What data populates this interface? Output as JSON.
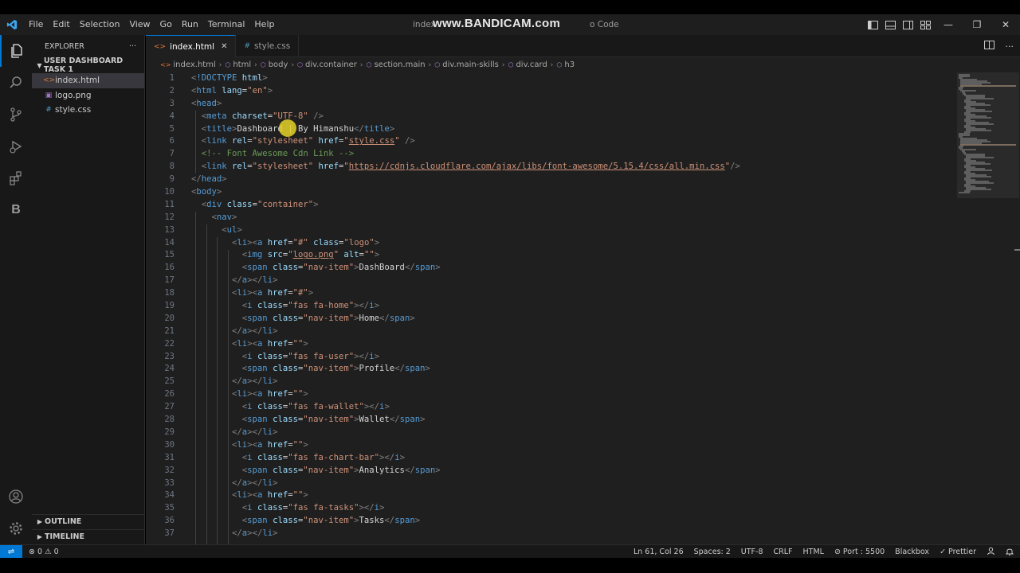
{
  "watermark": "www.BANDICAM.com",
  "window": {
    "title_left": "index",
    "title_right": "o Code",
    "minimize": "—",
    "restore": "❐",
    "close": "✕"
  },
  "menu": [
    "File",
    "Edit",
    "Selection",
    "View",
    "Go",
    "Run",
    "Terminal",
    "Help"
  ],
  "sidebar": {
    "title": "EXPLORER",
    "more": "···",
    "folder": "USER DASHBOARD TASK 1",
    "files": [
      {
        "name": "index.html",
        "icon": "html-file-icon",
        "glyph": "<>"
      },
      {
        "name": "logo.png",
        "icon": "image-file-icon",
        "glyph": "▣"
      },
      {
        "name": "style.css",
        "icon": "css-file-icon",
        "glyph": "#"
      }
    ],
    "outline": "OUTLINE",
    "timeline": "TIMELINE"
  },
  "tabs": [
    {
      "label": "index.html",
      "glyph": "<>",
      "active": true,
      "close": "✕"
    },
    {
      "label": "style.css",
      "glyph": "#",
      "active": false
    }
  ],
  "breadcrumb": [
    "index.html",
    "html",
    "body",
    "div.container",
    "section.main",
    "div.main-skills",
    "div.card",
    "h3"
  ],
  "editor": {
    "line_numbers": [
      "1",
      "2",
      "3",
      "4",
      "5",
      "6",
      "7",
      "8",
      "9",
      "10",
      "11",
      "12",
      "13",
      "14",
      "15",
      "16",
      "17",
      "18",
      "19",
      "20",
      "21",
      "22",
      "23",
      "24",
      "25",
      "26",
      "27",
      "28",
      "29",
      "30",
      "31",
      "32",
      "33",
      "34",
      "35",
      "36",
      "37"
    ],
    "lines": [
      [
        [
          "t-br",
          "<"
        ],
        [
          "t-tag",
          "!DOCTYPE"
        ],
        [
          "t-attr",
          " html"
        ],
        [
          "t-br",
          ">"
        ]
      ],
      [
        [
          "t-br",
          "<"
        ],
        [
          "t-tag",
          "html"
        ],
        [
          "t-attr",
          " lang"
        ],
        [
          "t-txt",
          "="
        ],
        [
          "t-str",
          "\"en\""
        ],
        [
          "t-br",
          ">"
        ]
      ],
      [
        [
          "t-br",
          "<"
        ],
        [
          "t-tag",
          "head"
        ],
        [
          "t-br",
          ">"
        ]
      ],
      [
        [
          "t-txt",
          "  "
        ],
        [
          "t-br",
          "<"
        ],
        [
          "t-tag",
          "meta"
        ],
        [
          "t-attr",
          " charset"
        ],
        [
          "t-txt",
          "="
        ],
        [
          "t-str",
          "\"UTF-8\""
        ],
        [
          "t-txt",
          " "
        ],
        [
          "t-br",
          "/>"
        ]
      ],
      [
        [
          "t-txt",
          "  "
        ],
        [
          "t-br",
          "<"
        ],
        [
          "t-tag",
          "title"
        ],
        [
          "t-br",
          ">"
        ],
        [
          "t-txt",
          "Dashboard | By Himanshu"
        ],
        [
          "t-br",
          "</"
        ],
        [
          "t-tag",
          "title"
        ],
        [
          "t-br",
          ">"
        ]
      ],
      [
        [
          "t-txt",
          "  "
        ],
        [
          "t-br",
          "<"
        ],
        [
          "t-tag",
          "link"
        ],
        [
          "t-attr",
          " rel"
        ],
        [
          "t-txt",
          "="
        ],
        [
          "t-str",
          "\"stylesheet\""
        ],
        [
          "t-attr",
          " href"
        ],
        [
          "t-txt",
          "="
        ],
        [
          "t-str",
          "\""
        ],
        [
          "t-link",
          "style.css"
        ],
        [
          "t-str",
          "\""
        ],
        [
          "t-txt",
          " "
        ],
        [
          "t-br",
          "/>"
        ]
      ],
      [
        [
          "t-txt",
          "  "
        ],
        [
          "t-com",
          "<!-- Font Awesome Cdn Link -->"
        ]
      ],
      [
        [
          "t-txt",
          "  "
        ],
        [
          "t-br",
          "<"
        ],
        [
          "t-tag",
          "link"
        ],
        [
          "t-attr",
          " rel"
        ],
        [
          "t-txt",
          "="
        ],
        [
          "t-str",
          "\"stylesheet\""
        ],
        [
          "t-attr",
          " href"
        ],
        [
          "t-txt",
          "="
        ],
        [
          "t-str",
          "\""
        ],
        [
          "t-link",
          "https://cdnjs.cloudflare.com/ajax/libs/font-awesome/5.15.4/css/all.min.css"
        ],
        [
          "t-str",
          "\""
        ],
        [
          "t-br",
          "/>"
        ]
      ],
      [
        [
          "t-br",
          "</"
        ],
        [
          "t-tag",
          "head"
        ],
        [
          "t-br",
          ">"
        ]
      ],
      [
        [
          "t-br",
          "<"
        ],
        [
          "t-tag",
          "body"
        ],
        [
          "t-br",
          ">"
        ]
      ],
      [
        [
          "t-txt",
          "  "
        ],
        [
          "t-br",
          "<"
        ],
        [
          "t-tag",
          "div"
        ],
        [
          "t-attr",
          " class"
        ],
        [
          "t-txt",
          "="
        ],
        [
          "t-str",
          "\"container\""
        ],
        [
          "t-br",
          ">"
        ]
      ],
      [
        [
          "t-txt",
          "    "
        ],
        [
          "t-br",
          "<"
        ],
        [
          "t-tag",
          "nav"
        ],
        [
          "t-br",
          ">"
        ]
      ],
      [
        [
          "t-txt",
          "      "
        ],
        [
          "t-br",
          "<"
        ],
        [
          "t-tag",
          "ul"
        ],
        [
          "t-br",
          ">"
        ]
      ],
      [
        [
          "t-txt",
          "        "
        ],
        [
          "t-br",
          "<"
        ],
        [
          "t-tag",
          "li"
        ],
        [
          "t-br",
          "><"
        ],
        [
          "t-tag",
          "a"
        ],
        [
          "t-attr",
          " href"
        ],
        [
          "t-txt",
          "="
        ],
        [
          "t-str",
          "\"#\""
        ],
        [
          "t-attr",
          " class"
        ],
        [
          "t-txt",
          "="
        ],
        [
          "t-str",
          "\"logo\""
        ],
        [
          "t-br",
          ">"
        ]
      ],
      [
        [
          "t-txt",
          "          "
        ],
        [
          "t-br",
          "<"
        ],
        [
          "t-tag",
          "img"
        ],
        [
          "t-attr",
          " src"
        ],
        [
          "t-txt",
          "="
        ],
        [
          "t-str",
          "\""
        ],
        [
          "t-link",
          "logo.png"
        ],
        [
          "t-str",
          "\""
        ],
        [
          "t-attr",
          " alt"
        ],
        [
          "t-txt",
          "="
        ],
        [
          "t-str",
          "\"\""
        ],
        [
          "t-br",
          ">"
        ]
      ],
      [
        [
          "t-txt",
          "          "
        ],
        [
          "t-br",
          "<"
        ],
        [
          "t-tag",
          "span"
        ],
        [
          "t-attr",
          " class"
        ],
        [
          "t-txt",
          "="
        ],
        [
          "t-str",
          "\"nav-item\""
        ],
        [
          "t-br",
          ">"
        ],
        [
          "t-txt",
          "DashBoard"
        ],
        [
          "t-br",
          "</"
        ],
        [
          "t-tag",
          "span"
        ],
        [
          "t-br",
          ">"
        ]
      ],
      [
        [
          "t-txt",
          "        "
        ],
        [
          "t-br",
          "</"
        ],
        [
          "t-tag",
          "a"
        ],
        [
          "t-br",
          "></"
        ],
        [
          "t-tag",
          "li"
        ],
        [
          "t-br",
          ">"
        ]
      ],
      [
        [
          "t-txt",
          "        "
        ],
        [
          "t-br",
          "<"
        ],
        [
          "t-tag",
          "li"
        ],
        [
          "t-br",
          "><"
        ],
        [
          "t-tag",
          "a"
        ],
        [
          "t-attr",
          " href"
        ],
        [
          "t-txt",
          "="
        ],
        [
          "t-str",
          "\"#\""
        ],
        [
          "t-br",
          ">"
        ]
      ],
      [
        [
          "t-txt",
          "          "
        ],
        [
          "t-br",
          "<"
        ],
        [
          "t-tag",
          "i"
        ],
        [
          "t-attr",
          " class"
        ],
        [
          "t-txt",
          "="
        ],
        [
          "t-str",
          "\"fas fa-home\""
        ],
        [
          "t-br",
          "></"
        ],
        [
          "t-tag",
          "i"
        ],
        [
          "t-br",
          ">"
        ]
      ],
      [
        [
          "t-txt",
          "          "
        ],
        [
          "t-br",
          "<"
        ],
        [
          "t-tag",
          "span"
        ],
        [
          "t-attr",
          " class"
        ],
        [
          "t-txt",
          "="
        ],
        [
          "t-str",
          "\"nav-item\""
        ],
        [
          "t-br",
          ">"
        ],
        [
          "t-txt",
          "Home"
        ],
        [
          "t-br",
          "</"
        ],
        [
          "t-tag",
          "span"
        ],
        [
          "t-br",
          ">"
        ]
      ],
      [
        [
          "t-txt",
          "        "
        ],
        [
          "t-br",
          "</"
        ],
        [
          "t-tag",
          "a"
        ],
        [
          "t-br",
          "></"
        ],
        [
          "t-tag",
          "li"
        ],
        [
          "t-br",
          ">"
        ]
      ],
      [
        [
          "t-txt",
          "        "
        ],
        [
          "t-br",
          "<"
        ],
        [
          "t-tag",
          "li"
        ],
        [
          "t-br",
          "><"
        ],
        [
          "t-tag",
          "a"
        ],
        [
          "t-attr",
          " href"
        ],
        [
          "t-txt",
          "="
        ],
        [
          "t-str",
          "\"\""
        ],
        [
          "t-br",
          ">"
        ]
      ],
      [
        [
          "t-txt",
          "          "
        ],
        [
          "t-br",
          "<"
        ],
        [
          "t-tag",
          "i"
        ],
        [
          "t-attr",
          " class"
        ],
        [
          "t-txt",
          "="
        ],
        [
          "t-str",
          "\"fas fa-user\""
        ],
        [
          "t-br",
          "></"
        ],
        [
          "t-tag",
          "i"
        ],
        [
          "t-br",
          ">"
        ]
      ],
      [
        [
          "t-txt",
          "          "
        ],
        [
          "t-br",
          "<"
        ],
        [
          "t-tag",
          "span"
        ],
        [
          "t-attr",
          " class"
        ],
        [
          "t-txt",
          "="
        ],
        [
          "t-str",
          "\"nav-item\""
        ],
        [
          "t-br",
          ">"
        ],
        [
          "t-txt",
          "Profile"
        ],
        [
          "t-br",
          "</"
        ],
        [
          "t-tag",
          "span"
        ],
        [
          "t-br",
          ">"
        ]
      ],
      [
        [
          "t-txt",
          "        "
        ],
        [
          "t-br",
          "</"
        ],
        [
          "t-tag",
          "a"
        ],
        [
          "t-br",
          "></"
        ],
        [
          "t-tag",
          "li"
        ],
        [
          "t-br",
          ">"
        ]
      ],
      [
        [
          "t-txt",
          "        "
        ],
        [
          "t-br",
          "<"
        ],
        [
          "t-tag",
          "li"
        ],
        [
          "t-br",
          "><"
        ],
        [
          "t-tag",
          "a"
        ],
        [
          "t-attr",
          " href"
        ],
        [
          "t-txt",
          "="
        ],
        [
          "t-str",
          "\"\""
        ],
        [
          "t-br",
          ">"
        ]
      ],
      [
        [
          "t-txt",
          "          "
        ],
        [
          "t-br",
          "<"
        ],
        [
          "t-tag",
          "i"
        ],
        [
          "t-attr",
          " class"
        ],
        [
          "t-txt",
          "="
        ],
        [
          "t-str",
          "\"fas fa-wallet\""
        ],
        [
          "t-br",
          "></"
        ],
        [
          "t-tag",
          "i"
        ],
        [
          "t-br",
          ">"
        ]
      ],
      [
        [
          "t-txt",
          "          "
        ],
        [
          "t-br",
          "<"
        ],
        [
          "t-tag",
          "span"
        ],
        [
          "t-attr",
          " class"
        ],
        [
          "t-txt",
          "="
        ],
        [
          "t-str",
          "\"nav-item\""
        ],
        [
          "t-br",
          ">"
        ],
        [
          "t-txt",
          "Wallet"
        ],
        [
          "t-br",
          "</"
        ],
        [
          "t-tag",
          "span"
        ],
        [
          "t-br",
          ">"
        ]
      ],
      [
        [
          "t-txt",
          "        "
        ],
        [
          "t-br",
          "</"
        ],
        [
          "t-tag",
          "a"
        ],
        [
          "t-br",
          "></"
        ],
        [
          "t-tag",
          "li"
        ],
        [
          "t-br",
          ">"
        ]
      ],
      [
        [
          "t-txt",
          "        "
        ],
        [
          "t-br",
          "<"
        ],
        [
          "t-tag",
          "li"
        ],
        [
          "t-br",
          "><"
        ],
        [
          "t-tag",
          "a"
        ],
        [
          "t-attr",
          " href"
        ],
        [
          "t-txt",
          "="
        ],
        [
          "t-str",
          "\"\""
        ],
        [
          "t-br",
          ">"
        ]
      ],
      [
        [
          "t-txt",
          "          "
        ],
        [
          "t-br",
          "<"
        ],
        [
          "t-tag",
          "i"
        ],
        [
          "t-attr",
          " class"
        ],
        [
          "t-txt",
          "="
        ],
        [
          "t-str",
          "\"fas fa-chart-bar\""
        ],
        [
          "t-br",
          "></"
        ],
        [
          "t-tag",
          "i"
        ],
        [
          "t-br",
          ">"
        ]
      ],
      [
        [
          "t-txt",
          "          "
        ],
        [
          "t-br",
          "<"
        ],
        [
          "t-tag",
          "span"
        ],
        [
          "t-attr",
          " class"
        ],
        [
          "t-txt",
          "="
        ],
        [
          "t-str",
          "\"nav-item\""
        ],
        [
          "t-br",
          ">"
        ],
        [
          "t-txt",
          "Analytics"
        ],
        [
          "t-br",
          "</"
        ],
        [
          "t-tag",
          "span"
        ],
        [
          "t-br",
          ">"
        ]
      ],
      [
        [
          "t-txt",
          "        "
        ],
        [
          "t-br",
          "</"
        ],
        [
          "t-tag",
          "a"
        ],
        [
          "t-br",
          "></"
        ],
        [
          "t-tag",
          "li"
        ],
        [
          "t-br",
          ">"
        ]
      ],
      [
        [
          "t-txt",
          "        "
        ],
        [
          "t-br",
          "<"
        ],
        [
          "t-tag",
          "li"
        ],
        [
          "t-br",
          "><"
        ],
        [
          "t-tag",
          "a"
        ],
        [
          "t-attr",
          " href"
        ],
        [
          "t-txt",
          "="
        ],
        [
          "t-str",
          "\"\""
        ],
        [
          "t-br",
          ">"
        ]
      ],
      [
        [
          "t-txt",
          "          "
        ],
        [
          "t-br",
          "<"
        ],
        [
          "t-tag",
          "i"
        ],
        [
          "t-attr",
          " class"
        ],
        [
          "t-txt",
          "="
        ],
        [
          "t-str",
          "\"fas fa-tasks\""
        ],
        [
          "t-br",
          "></"
        ],
        [
          "t-tag",
          "i"
        ],
        [
          "t-br",
          ">"
        ]
      ],
      [
        [
          "t-txt",
          "          "
        ],
        [
          "t-br",
          "<"
        ],
        [
          "t-tag",
          "span"
        ],
        [
          "t-attr",
          " class"
        ],
        [
          "t-txt",
          "="
        ],
        [
          "t-str",
          "\"nav-item\""
        ],
        [
          "t-br",
          ">"
        ],
        [
          "t-txt",
          "Tasks"
        ],
        [
          "t-br",
          "</"
        ],
        [
          "t-tag",
          "span"
        ],
        [
          "t-br",
          ">"
        ]
      ],
      [
        [
          "t-txt",
          "        "
        ],
        [
          "t-br",
          "</"
        ],
        [
          "t-tag",
          "a"
        ],
        [
          "t-br",
          "></"
        ],
        [
          "t-tag",
          "li"
        ],
        [
          "t-br",
          ">"
        ]
      ]
    ]
  },
  "statusbar": {
    "remote": "⇌",
    "errors": "⊗ 0 ⚠ 0",
    "position": "Ln 61, Col 26",
    "spaces": "Spaces: 2",
    "encoding": "UTF-8",
    "eol": "CRLF",
    "language": "HTML",
    "port": "⊘ Port : 5500",
    "blackbox": "Blackbox",
    "prettier": "✓ Prettier",
    "feedback_icon": "person-icon",
    "bell_icon": "bell-icon"
  },
  "colors": {
    "accent": "#0078d4",
    "editor_bg": "#1f1f1f",
    "sidebar_bg": "#181818",
    "tag": "#569cd6",
    "attr": "#9cdcfe",
    "string": "#ce9178",
    "comment": "#6a9955"
  }
}
